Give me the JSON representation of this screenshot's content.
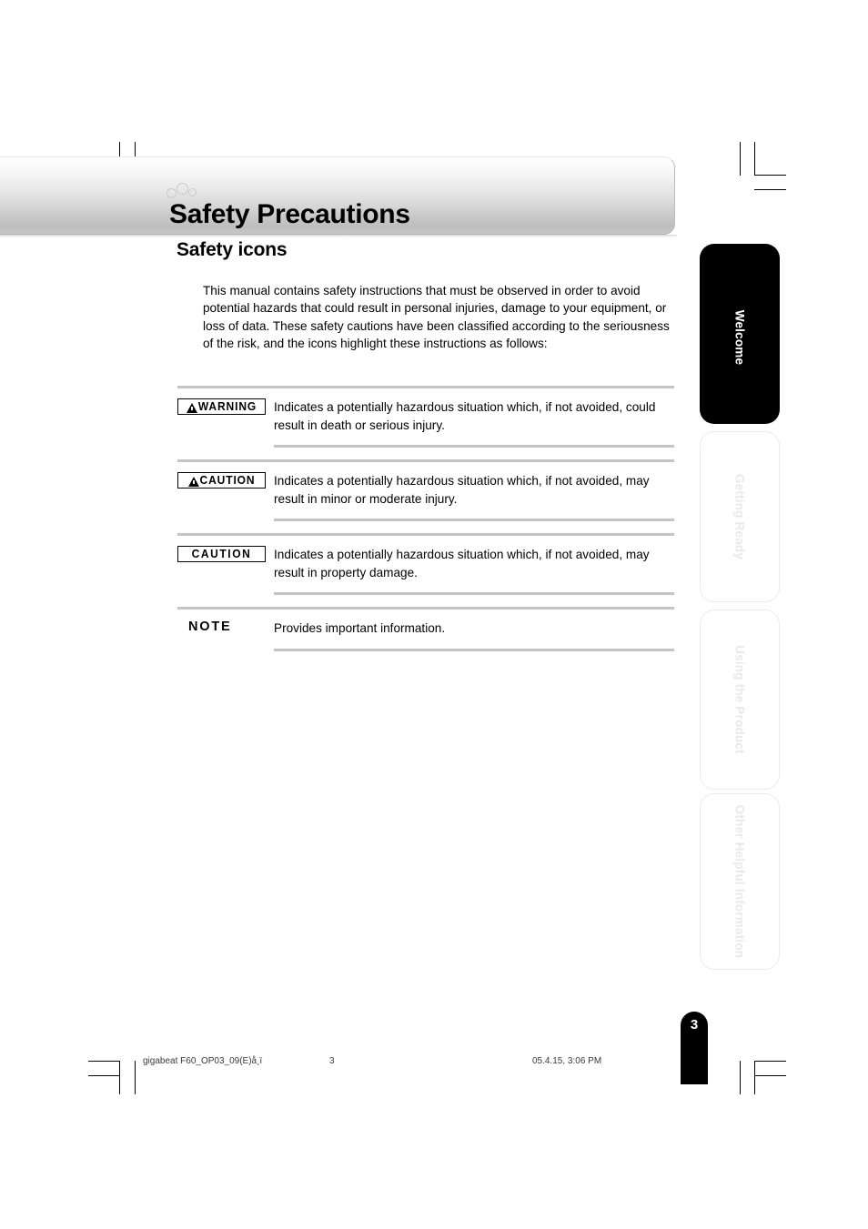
{
  "document": {
    "page_title": "Safety Precautions",
    "section_title": "Safety icons",
    "intro_paragraph": "This manual contains safety instructions that must be observed in order to avoid potential hazards that could result in personal injuries, damage to your equipment, or loss of data. These safety cautions have been classified according to the seriousness of the risk, and the icons highlight these instructions as follows:"
  },
  "icon_rows": [
    {
      "label": "WARNING",
      "has_triangle": true,
      "boxed": true,
      "description": "Indicates a potentially hazardous situation which, if not avoided, could result in death or serious injury."
    },
    {
      "label": "CAUTION",
      "has_triangle": true,
      "boxed": true,
      "description": "Indicates a potentially hazardous situation which, if not avoided, may result in minor or moderate injury."
    },
    {
      "label": "CAUTION",
      "has_triangle": false,
      "boxed": true,
      "description": "Indicates a potentially hazardous situation which, if not avoided, may result in property damage."
    },
    {
      "label": "NOTE",
      "has_triangle": false,
      "boxed": false,
      "description": "Provides important information."
    }
  ],
  "side_tabs": [
    {
      "label": "Welcome",
      "active": true
    },
    {
      "label": "Getting Ready",
      "active": false
    },
    {
      "label": "Using the Product",
      "active": false
    },
    {
      "label": "Other Helpful Information",
      "active": false
    }
  ],
  "page_number": "3",
  "footer": {
    "file_name": "gigabeat F60_OP03_09(E)å¸ï",
    "page": "3",
    "date": "05.4.15, 3:06 PM"
  },
  "colors": {
    "rule": "#c4c4c4",
    "active_tab_bg": "#000000",
    "inactive_tab_text": "#e9e9e9",
    "banner_gradient_end": "#c6c6c6"
  }
}
